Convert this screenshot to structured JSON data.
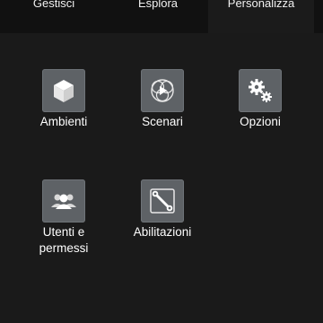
{
  "tabs": [
    {
      "label": "Gestisci"
    },
    {
      "label": "Esplora"
    },
    {
      "label": "Personalizza",
      "selected": true
    }
  ],
  "tiles": [
    {
      "label": "Ambienti",
      "icon": "cube-icon"
    },
    {
      "label": "Scenari",
      "icon": "scenes-play-icon"
    },
    {
      "label": "Opzioni",
      "icon": "gears-icon"
    },
    {
      "label_line1": "Utenti e",
      "label_line2": "permessi",
      "icon": "users-icon"
    },
    {
      "label": "Abilitazioni",
      "icon": "wrench-icon"
    }
  ],
  "colors": {
    "background": "#1a1a1a",
    "tabbar": "#111111",
    "tab_selected": "#1b1b1b",
    "icon_tile": "#5e6266",
    "text": "#ffffff"
  }
}
